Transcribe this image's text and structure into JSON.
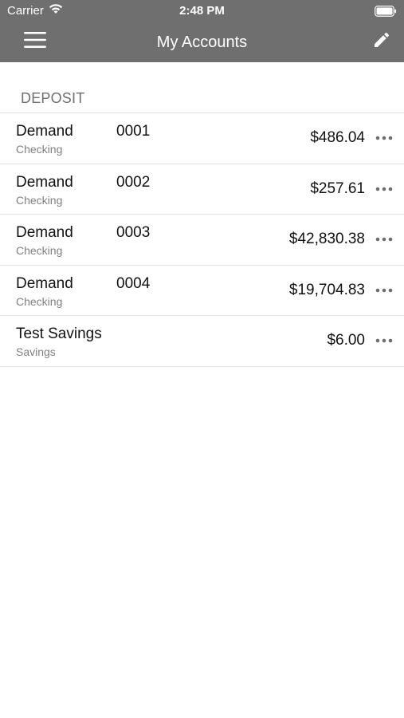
{
  "status_bar": {
    "carrier": "Carrier",
    "time": "2:48 PM",
    "wifi_icon": "wifi-icon",
    "battery_icon": "battery-icon"
  },
  "nav": {
    "title": "My Accounts",
    "menu_icon": "hamburger-menu-icon",
    "edit_icon": "pencil-icon"
  },
  "section": {
    "title": "DEPOSIT"
  },
  "accounts": [
    {
      "name": "Demand",
      "number": "0001",
      "type": "Checking",
      "balance": "$486.04"
    },
    {
      "name": "Demand",
      "number": "0002",
      "type": "Checking",
      "balance": "$257.61"
    },
    {
      "name": "Demand",
      "number": "0003",
      "type": "Checking",
      "balance": "$42,830.38"
    },
    {
      "name": "Demand",
      "number": "0004",
      "type": "Checking",
      "balance": "$19,704.83"
    },
    {
      "name": "Test Savings",
      "number": "",
      "type": "Savings",
      "balance": "$6.00"
    }
  ],
  "colors": {
    "header_bg": "#6f6f6f",
    "header_text": "#ffffff",
    "section_text": "#6f6f6f",
    "divider": "#e2e2e2",
    "more_dots": "#6f6f6f"
  }
}
